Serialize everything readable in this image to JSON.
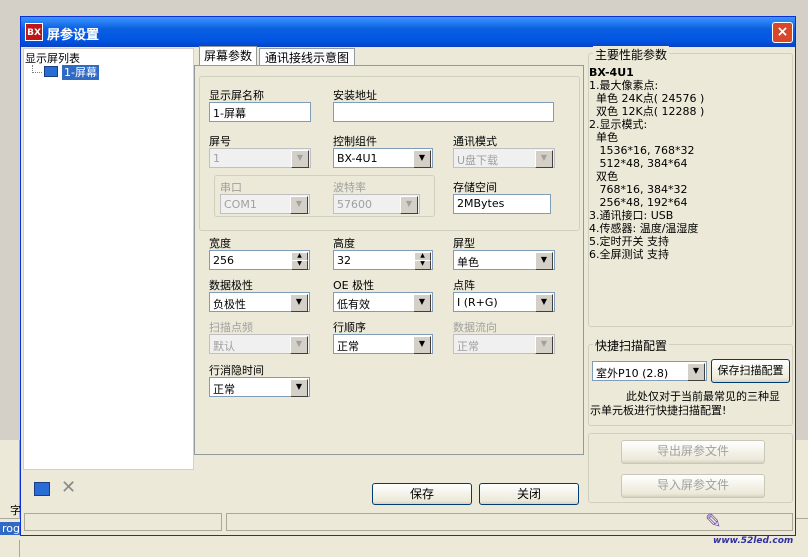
{
  "window": {
    "title": "屏参设置",
    "icon_text": "BX",
    "close": "×"
  },
  "left_panel": {
    "header": "显示屏列表",
    "items": [
      {
        "label": "1-屏幕"
      }
    ]
  },
  "tabs": [
    {
      "label": "屏幕参数"
    },
    {
      "label": "通讯接线示意图"
    }
  ],
  "form": {
    "name_label": "显示屏名称",
    "name_value": "1-屏幕",
    "addr_label": "安装地址",
    "addr_value": "",
    "screen_no_label": "屏号",
    "screen_no_value": "1",
    "control_label": "控制组件",
    "control_value": "BX-4U1",
    "comm_label": "通讯模式",
    "comm_value": "U盘下载",
    "serial_label": "串口",
    "serial_value": "COM1",
    "baud_label": "波特率",
    "baud_value": "57600",
    "storage_label": "存储空间",
    "storage_value": "2MBytes",
    "width_label": "宽度",
    "width_value": "256",
    "height_label": "高度",
    "height_value": "32",
    "type_label": "屏型",
    "type_value": "单色",
    "data_polarity_label": "数据极性",
    "data_polarity_value": "负极性",
    "oe_label": "OE 极性",
    "oe_value": "低有效",
    "dot_label": "点阵",
    "dot_value": "I (R+G)",
    "scan_label": "扫描点频",
    "scan_value": "默认",
    "row_order_label": "行顺序",
    "row_order_value": "正常",
    "flow_label": "数据流向",
    "flow_value": "正常",
    "blank_label": "行消隐时间",
    "blank_value": "正常"
  },
  "perf": {
    "title": "主要性能参数",
    "lines": [
      "BX-4U1",
      "1.最大像素点:",
      "  单色 24K点( 24576 )",
      "  双色 12K点( 12288 )",
      "2.显示模式:",
      "  单色",
      "   1536*16, 768*32",
      "   512*48, 384*64",
      "  双色",
      "   768*16, 384*32",
      "   256*48, 192*64",
      "3.通讯接口: USB",
      "4.传感器: 温度/温湿度",
      "5.定时开关 支持",
      "6.全屏测试 支持"
    ]
  },
  "quick": {
    "title": "快捷扫描配置",
    "preset_value": "室外P10 (2.8)",
    "save_label": "保存扫描配置",
    "note_line1": "此处仅对于当前最常见的三种显",
    "note_line2": "示单元板进行快捷扫描配置!"
  },
  "buttons": {
    "export": "导出屏参文件",
    "import": "导入屏参文件",
    "save": "保存",
    "close": "关闭"
  },
  "background": {
    "left_text": "字",
    "prog_text": "rog"
  },
  "watermark": "www.52led.com"
}
